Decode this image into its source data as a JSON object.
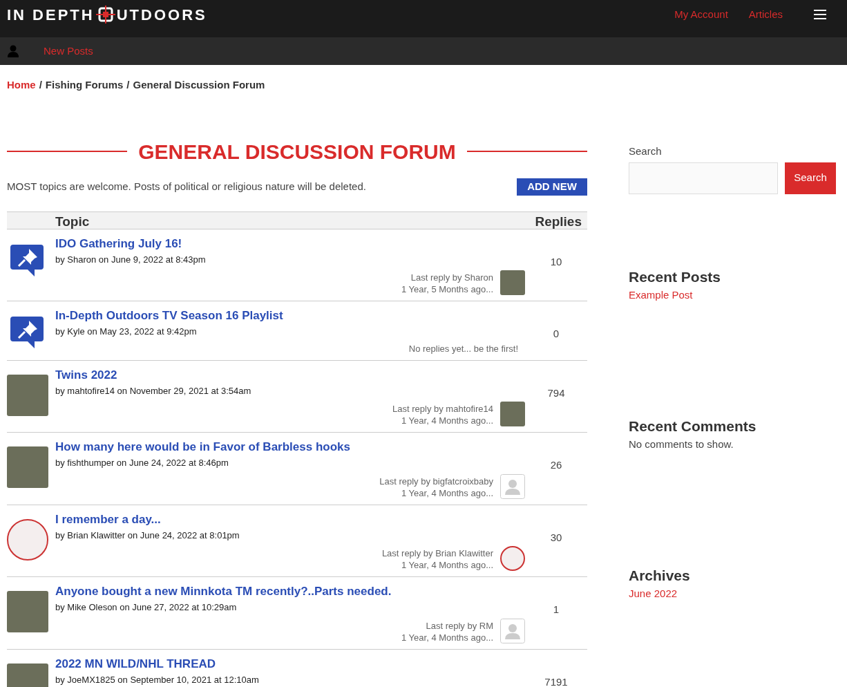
{
  "header": {
    "logo": {
      "left": "IN DEPTH",
      "right": "UTDOORS"
    },
    "nav": [
      "My Account",
      "Articles"
    ]
  },
  "subbar": {
    "link": "New Posts"
  },
  "breadcrumb_separator": "/",
  "breadcrumb": [
    {
      "label": "Home",
      "link": true
    },
    {
      "label": "Fishing Forums",
      "link": false
    },
    {
      "label": "General Discussion Forum",
      "link": false
    }
  ],
  "forum": {
    "title": "GENERAL DISCUSSION FORUM",
    "description": "MOST topics are welcome. Posts of political or religious nature will be deleted.",
    "add_button": "ADD NEW"
  },
  "table": {
    "columns": [
      "Topic",
      "Replies"
    ],
    "rows": [
      {
        "title": "IDO Gathering July 16!",
        "meta": "by Sharon on June 9, 2022 at 8:43pm",
        "avatar": {
          "kind": "pin"
        },
        "last_reply": "Last reply by Sharon",
        "ago": "1 Year, 5 Months ago...",
        "reply_avatar": {
          "kind": "photo"
        },
        "replies": "10"
      },
      {
        "title": "In-Depth Outdoors TV Season 16 Playlist",
        "meta": "by Kyle on May 23, 2022 at 9:42pm",
        "avatar": {
          "kind": "pin"
        },
        "last_reply": "No replies yet... be the first!",
        "replies": "0"
      },
      {
        "title": "Twins 2022",
        "meta": "by mahtofire14 on November 29, 2021 at 3:54am",
        "avatar": {
          "kind": "photo"
        },
        "last_reply": "Last reply by mahtofire14",
        "ago": "1 Year, 4 Months ago...",
        "reply_avatar": {
          "kind": "photo"
        },
        "replies": "794"
      },
      {
        "title": "How many here would be in Favor of Barbless hooks",
        "meta": "by fishthumper on June 24, 2022 at 8:46pm",
        "avatar": {
          "kind": "photo"
        },
        "last_reply": "Last reply by bigfatcroixbaby",
        "ago": "1 Year, 4 Months ago...",
        "reply_avatar": {
          "kind": "silhouette"
        },
        "replies": "26"
      },
      {
        "title": "I remember a day...",
        "meta": "by Brian Klawitter on June 24, 2022 at 8:01pm",
        "avatar": {
          "kind": "logo"
        },
        "last_reply": "Last reply by Brian Klawitter",
        "ago": "1 Year, 4 Months ago...",
        "reply_avatar": {
          "kind": "logo"
        },
        "replies": "30"
      },
      {
        "title": "Anyone bought a new Minnkota TM recently?..Parts needed.",
        "meta": "by Mike Oleson on June 27, 2022 at 10:29am",
        "avatar": {
          "kind": "photo"
        },
        "last_reply": "Last reply by RM",
        "ago": "1 Year, 4 Months ago...",
        "reply_avatar": {
          "kind": "silhouette"
        },
        "replies": "1"
      },
      {
        "title": "2022 MN WILD/NHL THREAD",
        "meta": "by JoeMX1825 on September 10, 2021 at 12:10am",
        "avatar": {
          "kind": "photo"
        },
        "replies": "7191"
      }
    ]
  },
  "sidebar": {
    "search_label": "Search",
    "search_button": "Search",
    "sections": [
      {
        "title": "Recent Posts",
        "items": [
          {
            "text": "Example Post",
            "link": true
          }
        ]
      },
      {
        "title": "Recent Comments",
        "items": [
          {
            "text": "No comments to show.",
            "link": false
          }
        ]
      },
      {
        "title": "Archives",
        "items": [
          {
            "text": "June 2022",
            "link": true
          }
        ]
      }
    ]
  }
}
